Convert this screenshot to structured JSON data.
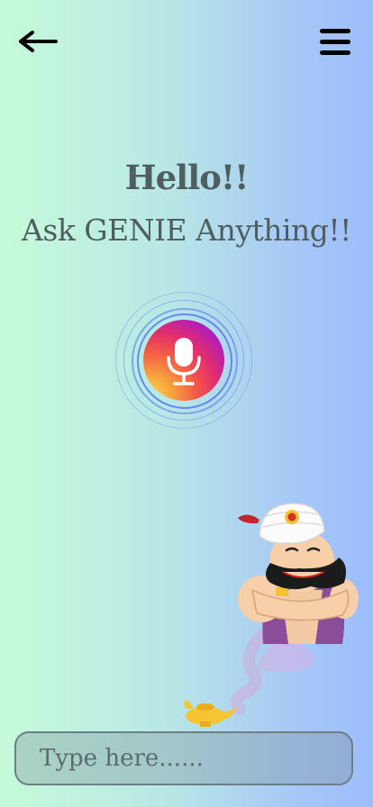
{
  "header": {
    "back_icon": "arrow-left-icon",
    "menu_icon": "hamburger-menu-icon"
  },
  "greeting": {
    "title": "Hello!!",
    "subtitle": "Ask GENIE Anything!!"
  },
  "mic": {
    "icon": "microphone-icon"
  },
  "illustration": {
    "name": "genie-with-lamp"
  },
  "input": {
    "placeholder": "Type here......",
    "value": ""
  }
}
